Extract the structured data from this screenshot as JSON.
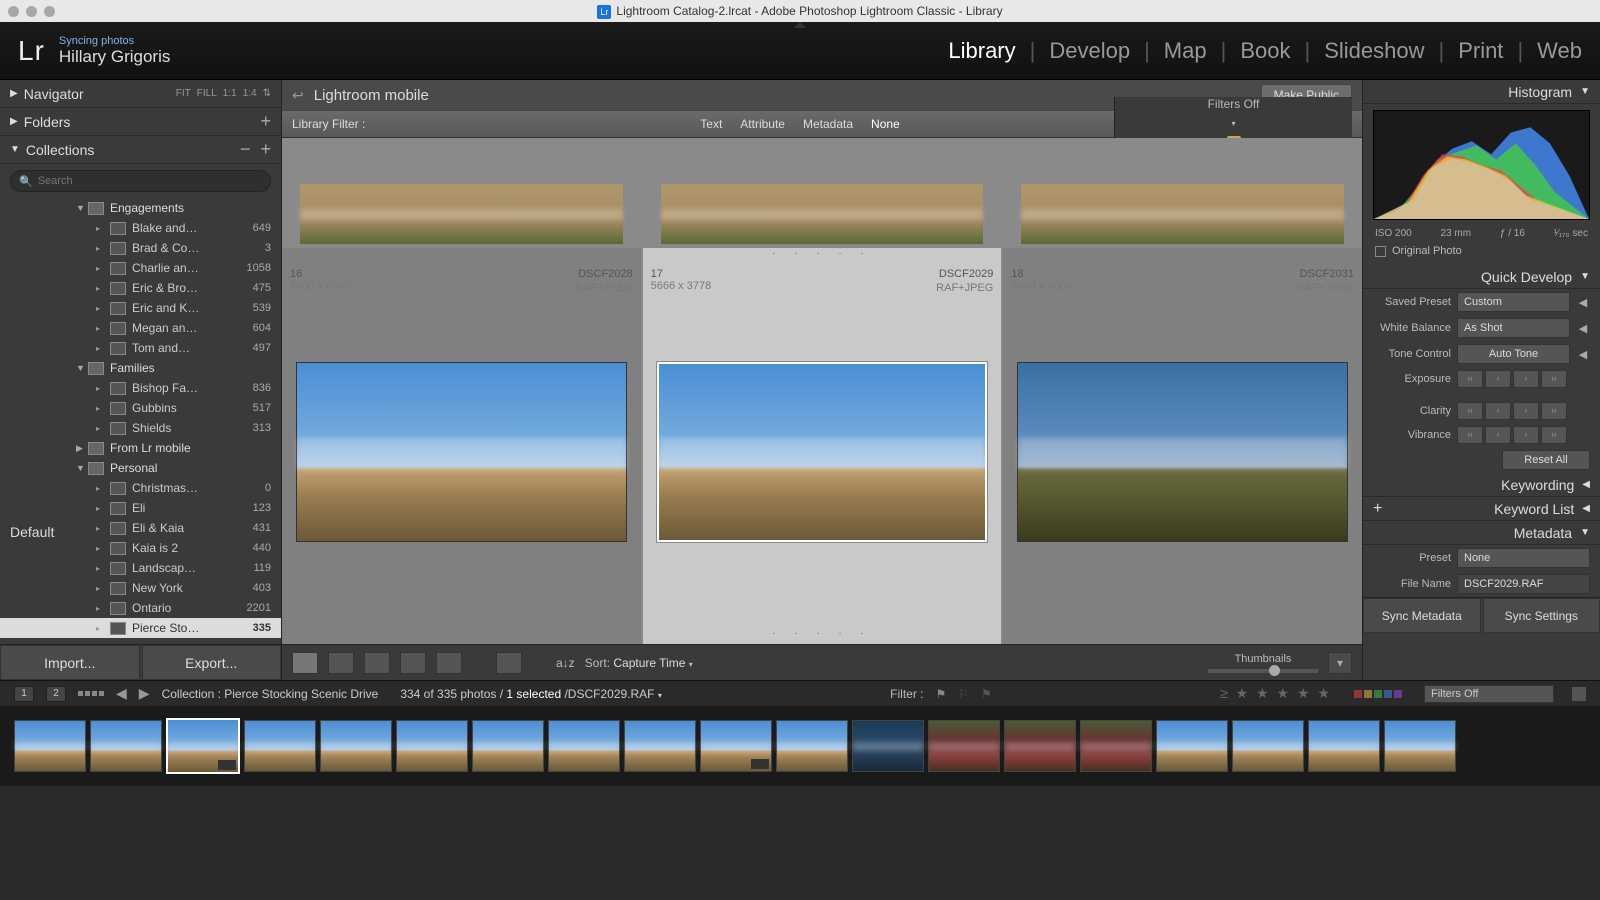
{
  "title": "Lightroom Catalog-2.lrcat - Adobe Photoshop Lightroom Classic - Library",
  "identity": {
    "sync": "Syncing photos",
    "user": "Hillary Grigoris"
  },
  "modules": [
    "Library",
    "Develop",
    "Map",
    "Book",
    "Slideshow",
    "Print",
    "Web"
  ],
  "activeModule": "Library",
  "left": {
    "navigator": "Navigator",
    "navopts": [
      "FIT",
      "FILL",
      "1:1",
      "1:4"
    ],
    "folders": "Folders",
    "collections": "Collections",
    "search_ph": "Search",
    "import": "Import...",
    "export": "Export...",
    "groups": [
      {
        "name": "Engagements",
        "expanded": true,
        "items": [
          {
            "name": "Blake and…",
            "count": 649
          },
          {
            "name": "Brad & Co…",
            "count": 3
          },
          {
            "name": "Charlie an…",
            "count": 1058
          },
          {
            "name": "Eric & Bro…",
            "count": 475
          },
          {
            "name": "Eric and K…",
            "count": 539
          },
          {
            "name": "Megan an…",
            "count": 604
          },
          {
            "name": "Tom and…",
            "count": 497
          }
        ]
      },
      {
        "name": "Families",
        "expanded": true,
        "items": [
          {
            "name": "Bishop Fa…",
            "count": 836
          },
          {
            "name": "Gubbins",
            "count": 517
          },
          {
            "name": "Shields",
            "count": 313
          }
        ]
      },
      {
        "name": "From Lr mobile",
        "expanded": false,
        "items": []
      },
      {
        "name": "Personal",
        "expanded": true,
        "items": [
          {
            "name": "Christmas…",
            "count": 0
          },
          {
            "name": "Eli",
            "count": 123
          },
          {
            "name": "Eli & Kaia",
            "count": 431
          },
          {
            "name": "Kaia is 2",
            "count": 440
          },
          {
            "name": "Landscap…",
            "count": 119
          },
          {
            "name": "New York",
            "count": 403
          },
          {
            "name": "Ontario",
            "count": 2201
          },
          {
            "name": "Pierce Sto…",
            "count": 335,
            "selected": true
          }
        ]
      }
    ]
  },
  "pathbar": {
    "title": "Lightroom mobile",
    "make_public": "Make Public"
  },
  "filterbar": {
    "label": "Library Filter :",
    "tabs": [
      "Text",
      "Attribute",
      "Metadata",
      "None"
    ],
    "active": "None",
    "filters_off": "Filters Off"
  },
  "cells": [
    {
      "idx": "16",
      "file": "DSCF2028",
      "dim": "6000 x 4000",
      "fmt": "RAF+JPEG"
    },
    {
      "idx": "17",
      "file": "DSCF2029",
      "dim": "5666 x 3778",
      "fmt": "RAF+JPEG",
      "selected": true
    },
    {
      "idx": "18",
      "file": "DSCF2031",
      "dim": "6000 x 4000",
      "fmt": "RAF+JPEG"
    }
  ],
  "toolbar": {
    "sort_lbl": "Sort:",
    "sort_val": "Capture Time",
    "thumbs": "Thumbnails"
  },
  "right": {
    "histogram": "Histogram",
    "histo_info": {
      "iso": "ISO 200",
      "focal": "23 mm",
      "ap": "ƒ / 16",
      "sh": "¹⁄₁₇₀ sec"
    },
    "orig": "Original Photo",
    "quick_develop": "Quick Develop",
    "saved_preset": "Saved Preset",
    "saved_preset_val": "Custom",
    "white_balance": "White Balance",
    "white_balance_val": "As Shot",
    "tone_control": "Tone Control",
    "auto_tone": "Auto Tone",
    "exposure": "Exposure",
    "clarity": "Clarity",
    "vibrance": "Vibrance",
    "reset_all": "Reset All",
    "keywording": "Keywording",
    "keyword_list": "Keyword List",
    "metadata": "Metadata",
    "default": "Default",
    "preset": "Preset",
    "preset_val": "None",
    "filename": "File Name",
    "filename_val": "DSCF2029.RAF",
    "sync_meta": "Sync Metadata",
    "sync_settings": "Sync Settings"
  },
  "status": {
    "pages": [
      "1",
      "2"
    ],
    "collection": "Collection : Pierce Stocking Scenic Drive",
    "count": "334 of 335 photos /",
    "selected": "1 selected",
    "slash_file": "/DSCF2029.RAF",
    "filter": "Filter :",
    "filters_off": "Filters Off"
  }
}
